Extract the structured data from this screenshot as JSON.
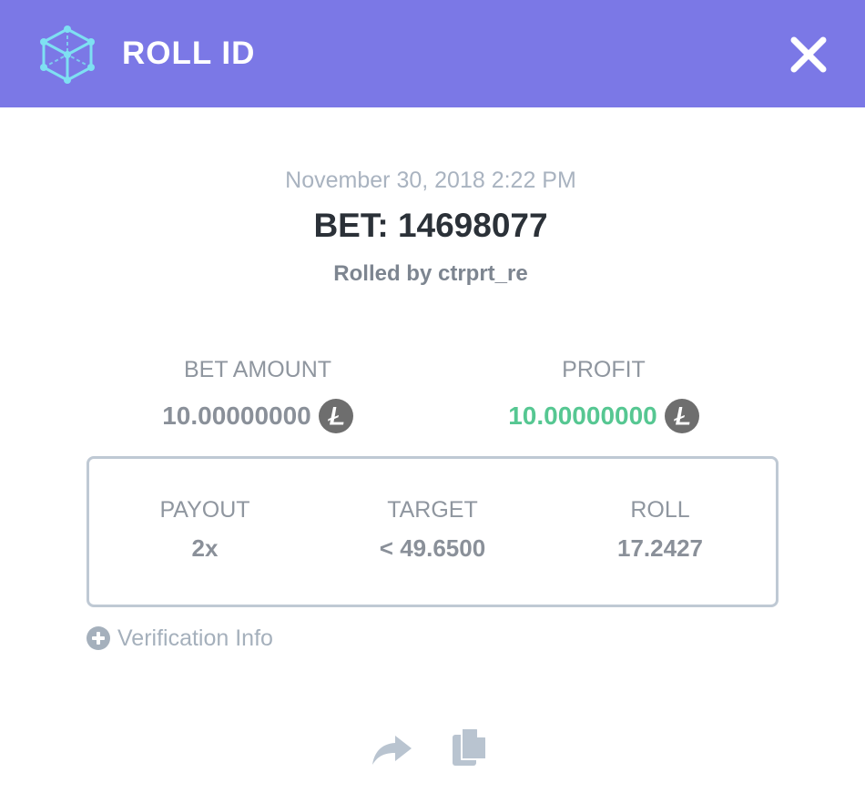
{
  "header": {
    "title": "ROLL ID",
    "logo_icon": "cube-icon",
    "close_icon": "close-icon",
    "background": "#7b78e6"
  },
  "bet": {
    "date": "November 30, 2018 2:22 PM",
    "id_label": "BET: 14698077",
    "rolled_by": "Rolled by ctrprt_re"
  },
  "stats": {
    "bet_amount_label": "BET AMOUNT",
    "bet_amount_value": "10.00000000",
    "profit_label": "PROFIT",
    "profit_value": "10.00000000",
    "currency_icon": "litecoin-icon",
    "profit_color": "#56c792"
  },
  "results": {
    "payout_label": "PAYOUT",
    "payout_value": "2x",
    "target_label": "TARGET",
    "target_value": "< 49.6500",
    "roll_label": "ROLL",
    "roll_value": "17.2427"
  },
  "verification": {
    "label": "Verification Info",
    "icon": "plus-circle-icon"
  },
  "actions": {
    "share_icon": "share-icon",
    "copy_icon": "copy-icon"
  }
}
